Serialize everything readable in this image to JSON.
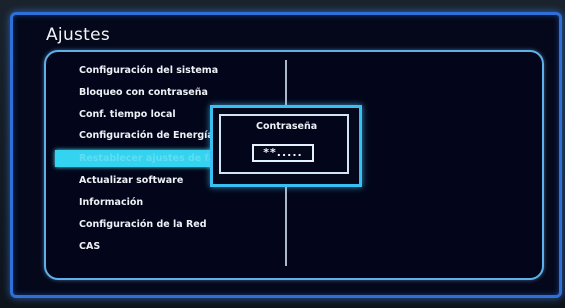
{
  "title": "Ajustes",
  "menu": {
    "items": [
      {
        "label": "Configuración del sistema"
      },
      {
        "label": "Bloqueo con contraseña"
      },
      {
        "label": "Conf. tiempo local"
      },
      {
        "label": "Configuración de Energía"
      },
      {
        "label": "Restablecer ajustes de fábrica"
      },
      {
        "label": "Actualizar software"
      },
      {
        "label": "Información"
      },
      {
        "label": "Configuración de la Red"
      },
      {
        "label": "CAS"
      }
    ],
    "selected_index": 4
  },
  "dialog": {
    "title": "Contraseña",
    "value": "**....."
  },
  "colors": {
    "frame": "#2f6fd8",
    "panel_border": "#5fb0e8",
    "highlight": "#34d4f0",
    "background": "#03061a",
    "text": "#eef2f6"
  }
}
